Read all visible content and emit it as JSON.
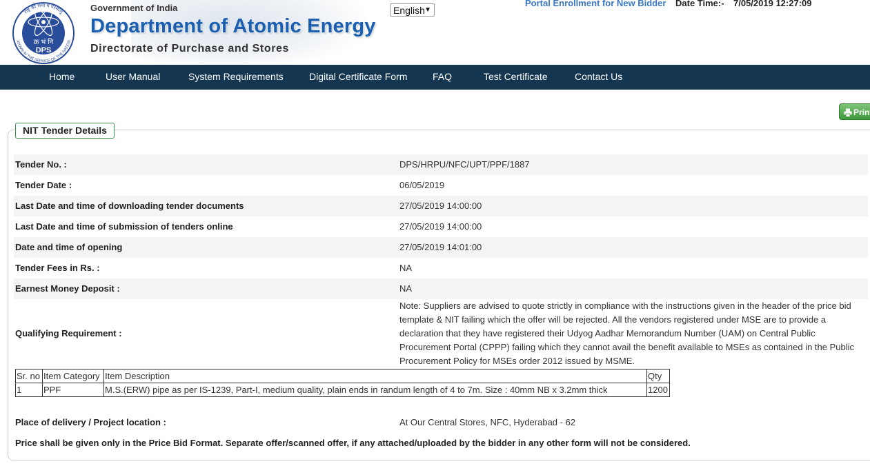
{
  "header": {
    "logo_text": "DPS",
    "logo_hindi": "क्र भं नि",
    "logo_ring_top": "राष्ट्र की सेवा में परमाणु",
    "logo_ring_bottom": "ATOMS IN THE SERVICE OF THE NATION",
    "government": "Government of India",
    "department": "Department of Atomic Energy",
    "directorate": "Directorate of Purchase and Stores",
    "language": "English",
    "enrollment_link": "Portal Enrollment for New Bidder",
    "datetime_label": "Date Time:-",
    "datetime_value": "7/05/2019 12:27:09"
  },
  "nav": [
    "Home",
    "User Manual",
    "System Requirements",
    "Digital Certificate Form",
    "FAQ",
    "Test Certificate",
    "Contact Us"
  ],
  "print_label": "Print",
  "section_title": "NIT Tender Details",
  "details": [
    {
      "label": "Tender No. :",
      "value": "DPS/HRPU/NFC/UPT/PPF/1887"
    },
    {
      "label": "Tender Date :",
      "value": "06/05/2019"
    },
    {
      "label": "Last Date and time of downloading tender documents",
      "value": "27/05/2019 14:00:00"
    },
    {
      "label": "Last Date and time of submission of tenders online",
      "value": "27/05/2019 14:00:00"
    },
    {
      "label": "Date and time of opening",
      "value": "27/05/2019 14:01:00"
    },
    {
      "label": "Tender Fees in Rs. :",
      "value": "NA"
    },
    {
      "label": "Earnest Money Deposit :",
      "value": "NA"
    }
  ],
  "qualifying": {
    "label": "Qualifying Requirement :",
    "text": "Note: Suppliers are advised to quote strictly in compliance with the instructions given in the header of the price bid template & NIT failing which the offer will be rejected. All the vendors registered under MSE are to provide a declaration that they have registered their Udyog Aadhar Memorandum Number (UAM) on Central Public Procurement Portal (CPPP) failing which they cannot avail the benefit available to MSEs as contained in the Public Procurement Policy for MSEs order 2012 issued by MSME."
  },
  "items_table": {
    "headers": [
      "Sr. no",
      "Item Category",
      "Item Description",
      "Qty"
    ],
    "rows": [
      [
        "1",
        "PPF",
        "M.S.(ERW) pipe as per IS-1239, Part-I, medium quality, plain ends in randum length of 4 to 7m. Size : 40mm NB x 3.2mm thick",
        "1200"
      ]
    ]
  },
  "delivery": {
    "label": "Place of delivery / Project location :",
    "value": "At Our Central Stores, NFC, Hyderabad - 62"
  },
  "price_note": "Price shall be given only in the Price Bid Format. Separate offer/scanned offer, if any attached/uploaded by the bidder in any other form will not be considered."
}
